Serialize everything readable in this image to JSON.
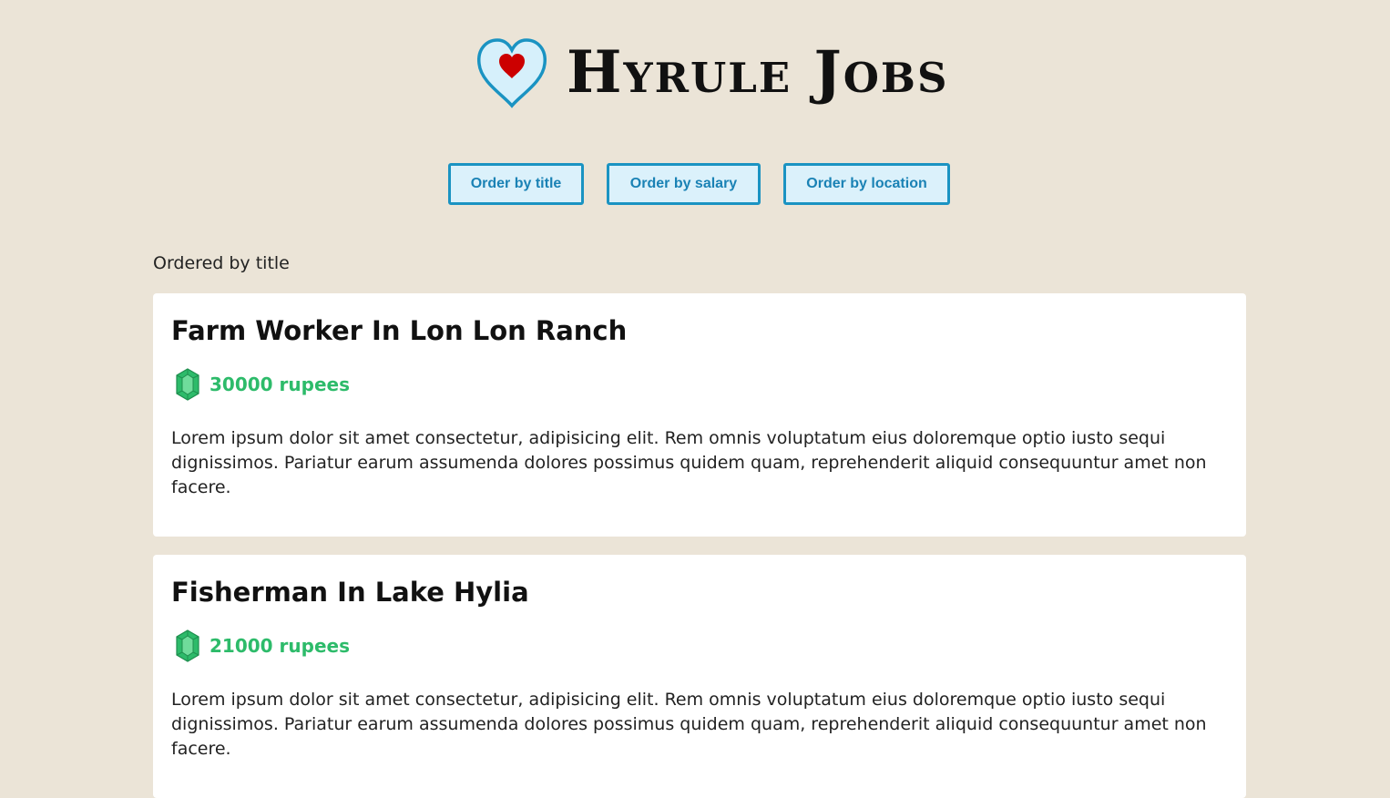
{
  "header": {
    "title": "Hyrule Jobs",
    "logo_icon": "heart-container-icon"
  },
  "sort_buttons": {
    "title_label": "Order by title",
    "salary_label": "Order by salary",
    "location_label": "Order by location"
  },
  "ordered_label": "Ordered by title",
  "jobs": [
    {
      "title": "Farm Worker In Lon Lon Ranch",
      "salary": "30000 rupees",
      "description": "Lorem ipsum dolor sit amet consectetur, adipisicing elit. Rem omnis voluptatum eius doloremque optio iusto sequi dignissimos. Pariatur earum assumenda dolores possimus quidem quam, reprehenderit aliquid consequuntur amet non facere."
    },
    {
      "title": "Fisherman In Lake Hylia",
      "salary": "21000 rupees",
      "description": "Lorem ipsum dolor sit amet consectetur, adipisicing elit. Rem omnis voluptatum eius doloremque optio iusto sequi dignissimos. Pariatur earum assumenda dolores possimus quidem quam, reprehenderit aliquid consequuntur amet non facere."
    }
  ],
  "colors": {
    "background": "#ebe4d7",
    "button_border": "#1a93c2",
    "button_fill": "#dbf1fb",
    "salary_green": "#2dbb6a",
    "heart_red": "#cc0000"
  }
}
